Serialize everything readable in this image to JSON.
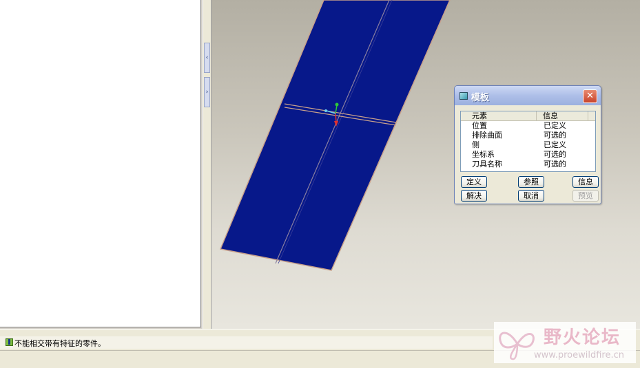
{
  "dialog": {
    "title": "模板",
    "close_glyph": "✕",
    "list_headers": {
      "col1": "元素",
      "col2": "信息"
    },
    "rows": [
      {
        "element": "位置",
        "info": "已定义"
      },
      {
        "element": "排除曲面",
        "info": "可选的"
      },
      {
        "element": "侧",
        "info": "已定义"
      },
      {
        "element": "坐标系",
        "info": "可选的"
      },
      {
        "element": "刀具名称",
        "info": "可选的"
      }
    ],
    "buttons": {
      "define": "定义",
      "reference": "参照",
      "info": "信息",
      "resolve": "解决",
      "cancel": "取消",
      "preview": "预览"
    }
  },
  "splitter": {
    "arrow_left": "‹",
    "arrow_right": "›"
  },
  "status": {
    "message": "不能相交带有特征的零件。"
  },
  "watermark": {
    "name": "野火论坛",
    "url": "www.proewildfire.cn"
  },
  "colors": {
    "surface_fill": "#07188a",
    "surface_edge": "#c8a08a",
    "viewport_top": "#b3afa3",
    "viewport_bottom": "#e8e6de"
  }
}
